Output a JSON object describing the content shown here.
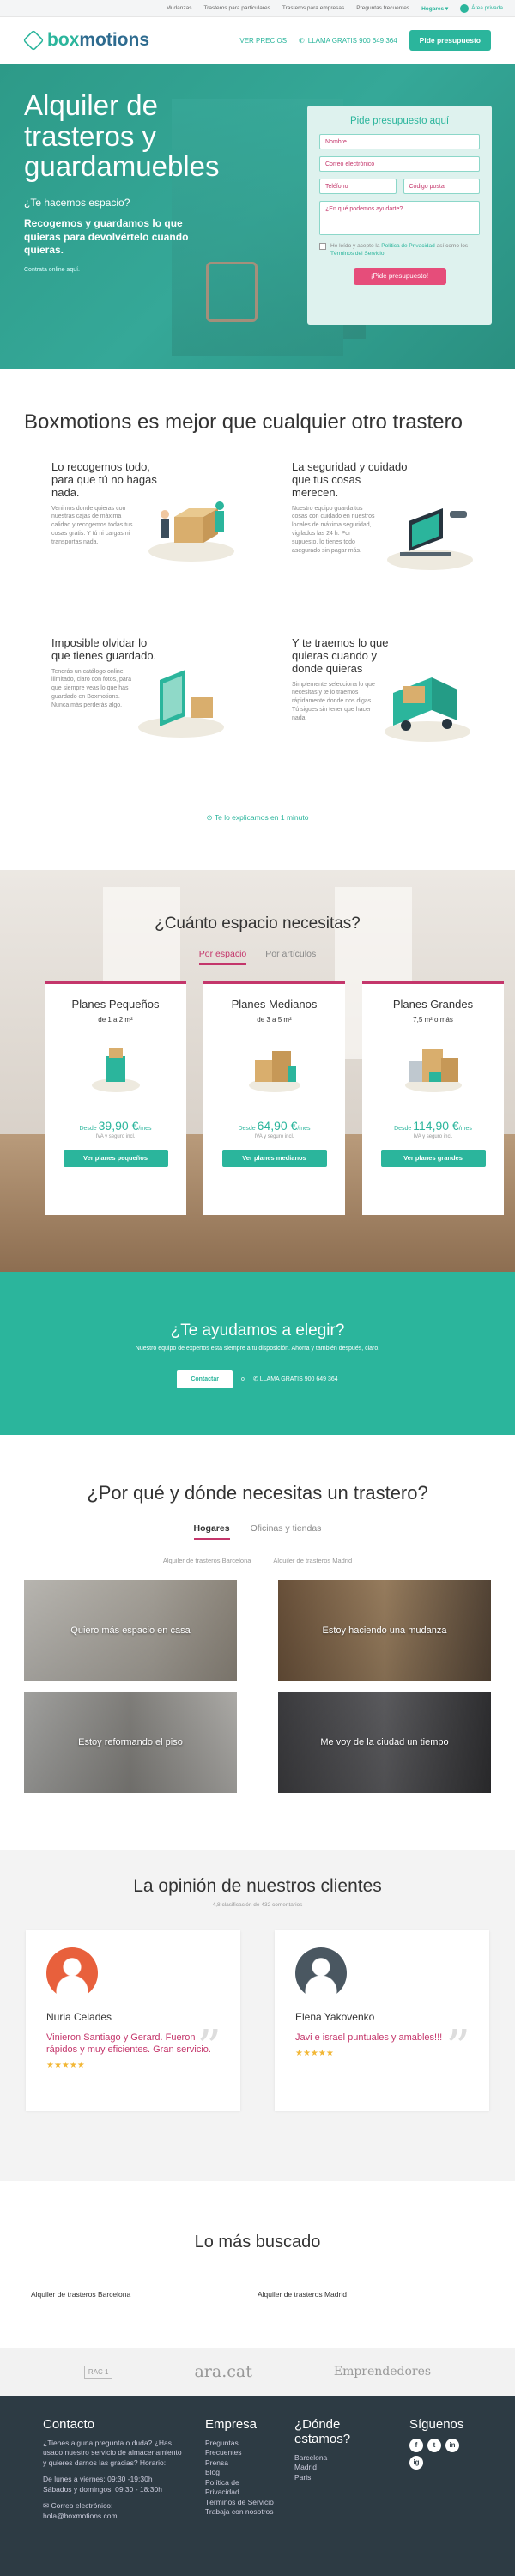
{
  "topbar": {
    "links": [
      "Mudanzas",
      "Trasteros para particulares",
      "Trasteros para empresas",
      "Preguntas frecuentes"
    ],
    "selector": "Hogares ▾",
    "login": "Área privada"
  },
  "header": {
    "logo_box": "box",
    "logo_rest": "motions",
    "ver_precios": "VER PRECIOS",
    "phone": "LLAMA GRATIS 900 649 364",
    "cta": "Pide presupuesto"
  },
  "hero": {
    "title": "Alquiler de trasteros y guardamuebles",
    "question": "¿Te hacemos espacio?",
    "desc": "Recogemos y guardamos lo que quieras para devolvértelo cuando quieras.",
    "small": "Contrata online aquí.",
    "form": {
      "title": "Pide presupuesto aquí",
      "nombre": "Nombre",
      "email": "Correo electrónico",
      "telefono": "Teléfono",
      "cp": "Código postal",
      "mensaje": "¿En qué podemos ayudarte?",
      "check_a": "He leído y acepto la ",
      "check_link1": "Política de Privacidad",
      "check_b": " así como los ",
      "check_link2": "Términos del Servicio",
      "submit": "¡Pide presupuesto!"
    }
  },
  "features": {
    "title": "Boxmotions es mejor que cualquier otro trastero",
    "items": [
      {
        "title": "Lo recogemos todo, para que tú no hagas nada.",
        "text": "Venimos donde quieras con nuestras cajas de máxima calidad y recogemos todas tus cosas gratis. Y tú ni cargas ni transportas nada."
      },
      {
        "title": "La seguridad y cuidado que tus cosas merecen.",
        "text": "Nuestro equipo guarda tus cosas con cuidado en nuestros locales de máxima seguridad, vigilados las 24 h. Por supuesto, lo tienes todo asegurado sin pagar más."
      },
      {
        "title": "Imposible olvidar lo que tienes guardado.",
        "text": "Tendrás un catálogo online ilimitado, claro con fotos, para que siempre veas lo que has guardado en Boxmotions. Nunca más perderás algo."
      },
      {
        "title": "Y te traemos lo que quieras cuando y donde quieras",
        "text": "Simplemente selecciona lo que necesitas y te lo traemos rápidamente donde nos digas. Tú sigues sin tener que hacer nada."
      }
    ],
    "explain": "Te lo explicamos en 1 minuto"
  },
  "space": {
    "title": "¿Cuánto espacio necesitas?",
    "tab_on": "Por espacio",
    "tab_off": "Por artículos",
    "plans": [
      {
        "name": "Planes Pequeños",
        "size": "de 1 a 2 m²",
        "from": "Desde ",
        "price": "39,90 €",
        "per": "/mes",
        "iva": "IVA y seguro incl.",
        "button": "Ver planes pequeños"
      },
      {
        "name": "Planes Medianos",
        "size": "de 3 a 5 m²",
        "from": "Desde ",
        "price": "64,90 €",
        "per": "/mes",
        "iva": "IVA y seguro incl.",
        "button": "Ver planes medianos"
      },
      {
        "name": "Planes Grandes",
        "size": "7,5 m² o más",
        "from": "Desde ",
        "price": "114,90 €",
        "per": "/mes",
        "iva": "IVA y seguro incl.",
        "button": "Ver planes grandes"
      }
    ]
  },
  "help": {
    "title": "¿Te ayudamos a elegir?",
    "text": "Nuestro equipo de expertos está siempre a tu disposición. Ahorra y también después, claro.",
    "button": "Contactar",
    "or": "o",
    "phone": "LLAMA GRATIS 900 649 364"
  },
  "why": {
    "title": "¿Por qué y dónde necesitas un trastero?",
    "tab_on": "Hogares",
    "tab_off": "Oficinas y tiendas",
    "sub1": "Alquiler de trasteros Barcelona",
    "sub2": "Alquiler de trasteros Madrid",
    "tiles": [
      "Quiero más espacio en casa",
      "Estoy haciendo una mudanza",
      "Estoy reformando el piso",
      "Me voy de la ciudad un tiempo"
    ]
  },
  "reviews": {
    "title": "La opinión de nuestros clientes",
    "sub": "4,8 clasificación de 432 comentarios",
    "items": [
      {
        "name": "Nuria Celades",
        "text": "Vinieron Santiago y Gerard. Fueron rápidos y muy eficientes. Gran servicio.",
        "stars": "★★★★★"
      },
      {
        "name": "Elena Yakovenko",
        "text": "Javi e israel puntuales y amables!!!",
        "stars": "★★★★★"
      }
    ]
  },
  "search": {
    "title": "Lo más buscado",
    "links": [
      "Alquiler de trasteros Barcelona",
      "Alquiler de trasteros Madrid"
    ]
  },
  "press": {
    "p1": "RAC 1",
    "p2": "ara.cat",
    "p3": "Emprendedores"
  },
  "footer": {
    "contact_title": "Contacto",
    "contact_text": "¿Tienes alguna pregunta o duda? ¿Has usado nuestro servicio de almacenamiento y quieres darnos las gracias? Horario:",
    "hours1": "De lunes a viernes: 09:30 -19:30h",
    "hours2": "Sábados y domingos: 09:30 - 18:30h",
    "email_label": "Correo electrónico:",
    "email": "hola@boxmotions.com",
    "empresa_title": "Empresa",
    "empresa_links": [
      "Preguntas Frecuentes",
      "Prensa",
      "Blog",
      "Política de Privacidad",
      "Términos de Servicio",
      "Trabaja con nosotros"
    ],
    "donde_title": "¿Dónde estamos?",
    "donde_links": [
      "Barcelona",
      "Madrid",
      "Paris"
    ],
    "siguenos_title": "Síguenos",
    "social": [
      "f",
      "t",
      "in",
      "ig"
    ]
  },
  "colors": {
    "accent": "#2bb59c",
    "brand": "#2e6b8f",
    "pink": "#c4366b",
    "cta": "#e64d7a"
  }
}
